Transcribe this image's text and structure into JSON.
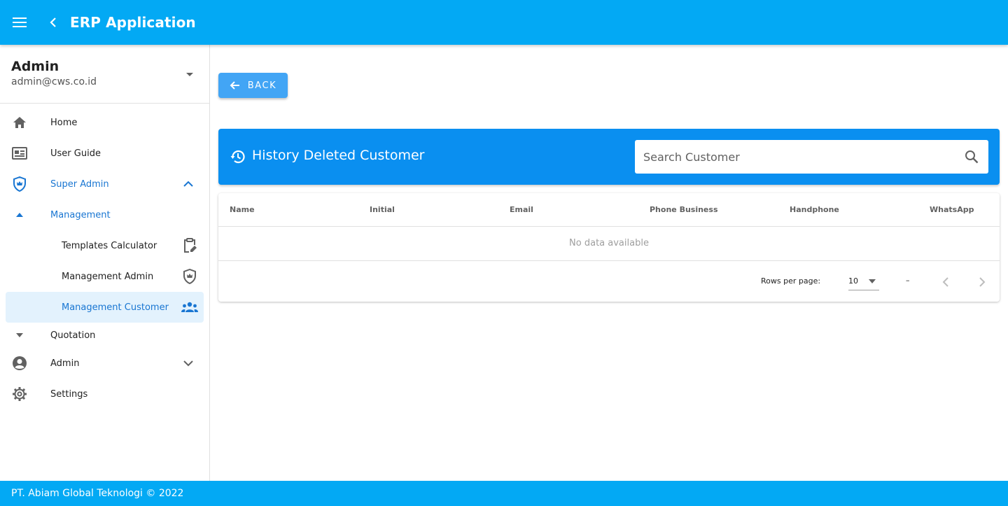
{
  "appbar": {
    "title": "ERP Application",
    "menu_icon": "menu-icon",
    "back_icon": "chevron-left-icon"
  },
  "account": {
    "name": "Admin",
    "email": "admin@cws.co.id"
  },
  "nav": {
    "home": "Home",
    "user_guide": "User Guide",
    "super_admin": "Super Admin",
    "management": "Management",
    "templates_calculator": "Templates Calculator",
    "management_admin": "Management Admin",
    "management_customer": "Management Customer",
    "quotation": "Quotation",
    "admin": "Admin",
    "settings": "Settings"
  },
  "main": {
    "back_label": "BACK",
    "history_title": "History Deleted Customer",
    "search_placeholder": "Search Customer",
    "table": {
      "headers": [
        "Name",
        "Initial",
        "Email",
        "Phone Business",
        "Handphone",
        "WhatsApp"
      ],
      "empty_text": "No data available",
      "rows_per_page_label": "Rows per page:",
      "rows_per_page": "10",
      "range": "–"
    }
  },
  "footer": {
    "text": "PT. Abiam Global Teknologi © 2022"
  },
  "colors": {
    "appbar": "#03a9f4",
    "header_card": "#0a8ff0",
    "back_button": "#42a5f5",
    "active_text": "#1976d2",
    "active_bg": "#e3f2fd"
  }
}
